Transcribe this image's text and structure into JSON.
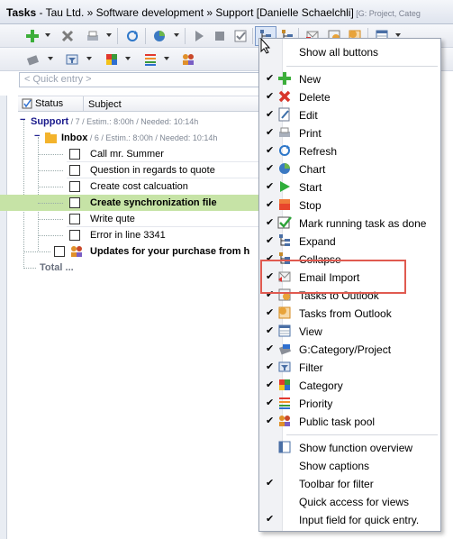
{
  "window": {
    "title_bold": "Tasks",
    "title_rest": " - Tau Ltd. » Software development » Support [Danielle Schaelchli]",
    "title_suffix": " [G: Project, Categ"
  },
  "quick_entry": {
    "placeholder": "< Quick entry >"
  },
  "grid": {
    "columns": [
      "Status",
      "Subject"
    ],
    "rows": [
      {
        "kind": "group",
        "label": "Support",
        "sub": " / 7 / Estim.: 8:00h / Needed: 10:14h"
      },
      {
        "kind": "group",
        "label": "Inbox",
        "sub": " / 6 / Estim.: 8:00h / Needed: 10:14h"
      },
      {
        "kind": "task",
        "label": "Call mr. Summer"
      },
      {
        "kind": "task",
        "label": "Question in regards to quote"
      },
      {
        "kind": "task",
        "label": "Create cost calcuation"
      },
      {
        "kind": "task",
        "label": "Create synchronization file",
        "selected": true
      },
      {
        "kind": "task",
        "label": "Write qute"
      },
      {
        "kind": "task",
        "label": "Error in line 3341"
      },
      {
        "kind": "task",
        "label": "Updates for your purchase from h"
      },
      {
        "kind": "total",
        "label": "Total ..."
      }
    ]
  },
  "menu": {
    "header": "Show all buttons",
    "items": [
      {
        "label": "New",
        "checked": true,
        "icon": "new-icon"
      },
      {
        "label": "Delete",
        "checked": true,
        "icon": "delete-icon"
      },
      {
        "label": "Edit",
        "checked": true,
        "icon": "edit-icon"
      },
      {
        "label": "Print",
        "checked": true,
        "icon": "print-icon"
      },
      {
        "label": "Refresh",
        "checked": true,
        "icon": "refresh-icon"
      },
      {
        "label": "Chart",
        "checked": true,
        "icon": "chart-icon"
      },
      {
        "label": "Start",
        "checked": true,
        "icon": "start-icon"
      },
      {
        "label": "Stop",
        "checked": true,
        "icon": "stop-icon"
      },
      {
        "label": "Mark running task as done",
        "checked": true,
        "icon": "mark-done-icon"
      },
      {
        "label": "Expand",
        "checked": true,
        "icon": "expand-icon"
      },
      {
        "label": "Collapse",
        "checked": true,
        "icon": "collapse-icon"
      },
      {
        "label": "Email Import",
        "checked": true,
        "icon": "email-import-icon"
      },
      {
        "label": "Tasks to Outlook",
        "checked": true,
        "icon": "tasks-to-outlook-icon"
      },
      {
        "label": "Tasks from Outlook",
        "checked": true,
        "icon": "tasks-from-outlook-icon"
      },
      {
        "label": "View",
        "checked": true,
        "icon": "view-icon"
      },
      {
        "label": "G:Category/Project",
        "checked": true,
        "icon": "group-icon"
      },
      {
        "label": "Filter",
        "checked": true,
        "icon": "filter-icon"
      },
      {
        "label": "Category",
        "checked": true,
        "icon": "category-icon"
      },
      {
        "label": "Priority",
        "checked": true,
        "icon": "priority-icon"
      },
      {
        "label": "Public task pool",
        "checked": true,
        "icon": "task-pool-icon"
      }
    ],
    "footer": [
      {
        "label": "Show function overview",
        "checked": false,
        "icon": "function-overview-icon"
      },
      {
        "label": "Show captions",
        "checked": false
      },
      {
        "label": "Toolbar for filter",
        "checked": true
      },
      {
        "label": "Quick access for views",
        "checked": false
      },
      {
        "label": "Input field for quick entry.",
        "checked": true
      }
    ]
  },
  "colors": {
    "accent": "#1a1a8c",
    "selection": "#c6e3a6",
    "highlight_box": "#e05a50"
  }
}
